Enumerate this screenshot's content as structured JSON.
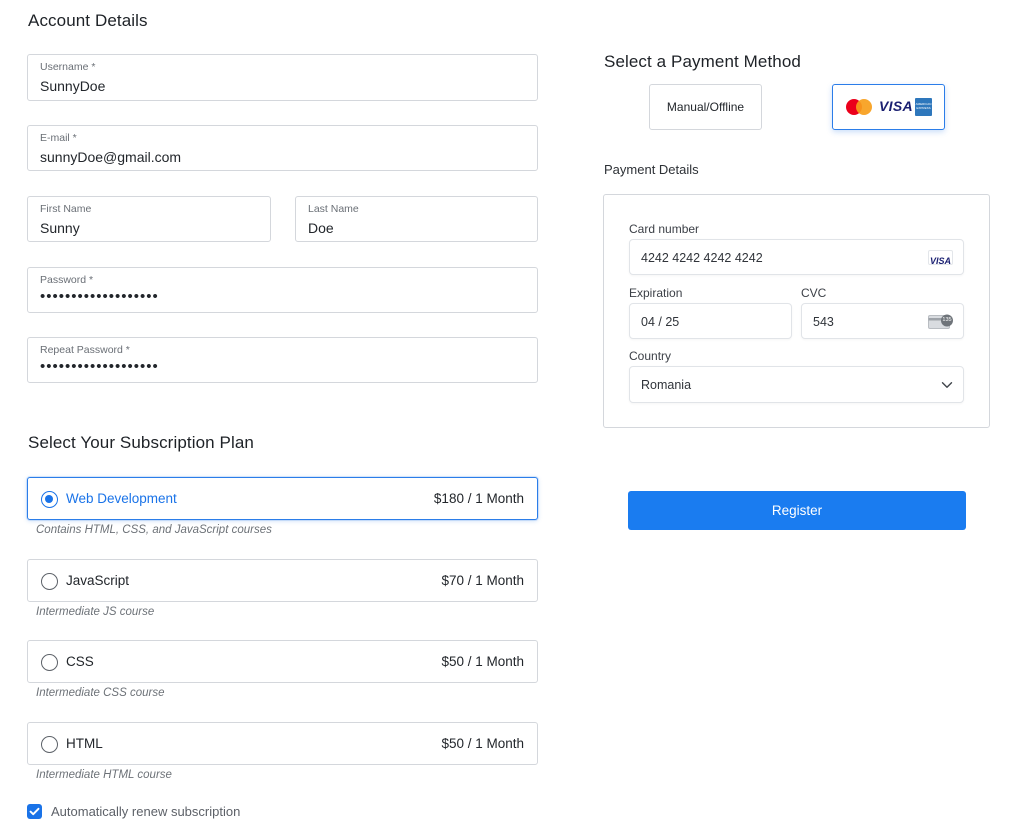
{
  "account": {
    "title": "Account Details",
    "username": {
      "label": "Username *",
      "value": "SunnyDoe"
    },
    "email": {
      "label": "E-mail *",
      "value": "sunnyDoe@gmail.com"
    },
    "first_name": {
      "label": "First Name",
      "value": "Sunny"
    },
    "last_name": {
      "label": "Last Name",
      "value": "Doe"
    },
    "password": {
      "label": "Password *",
      "value": "•••••••••••••••••••"
    },
    "repeat_password": {
      "label": "Repeat Password *",
      "value": "•••••••••••••••••••"
    }
  },
  "subscription": {
    "title": "Select Your Subscription Plan",
    "plans": [
      {
        "name": "Web Development",
        "price": "$180 / 1 Month",
        "description": "Contains HTML, CSS, and JavaScript courses",
        "selected": true
      },
      {
        "name": "JavaScript",
        "price": "$70 / 1 Month",
        "description": "Intermediate JS course",
        "selected": false
      },
      {
        "name": "CSS",
        "price": "$50 / 1 Month",
        "description": "Intermediate CSS course",
        "selected": false
      },
      {
        "name": "HTML",
        "price": "$50 / 1 Month",
        "description": "Intermediate HTML course",
        "selected": false
      }
    ],
    "auto_renew": {
      "label": "Automatically renew subscription",
      "checked": true
    }
  },
  "payment": {
    "title": "Select a Payment Method",
    "manual_label": "Manual/Offline",
    "card_logo_text": "VISA",
    "amex_text": "AMERICAN EXPRESS",
    "details_title": "Payment Details",
    "card_number": {
      "label": "Card number",
      "value": "4242 4242 4242 4242",
      "brand": "VISA"
    },
    "expiration": {
      "label": "Expiration",
      "value": "04 / 25"
    },
    "cvc": {
      "label": "CVC",
      "value": "543",
      "icon_text": "135"
    },
    "country": {
      "label": "Country",
      "value": "Romania"
    },
    "register_label": "Register"
  },
  "colors": {
    "accent": "#1a73e8",
    "button": "#1a7cf0",
    "border": "#d4d7dc",
    "mastercard_red": "#eb001b",
    "mastercard_orange": "#f79e1b",
    "visa_blue": "#1a1f71",
    "amex_blue": "#2e77bc"
  }
}
